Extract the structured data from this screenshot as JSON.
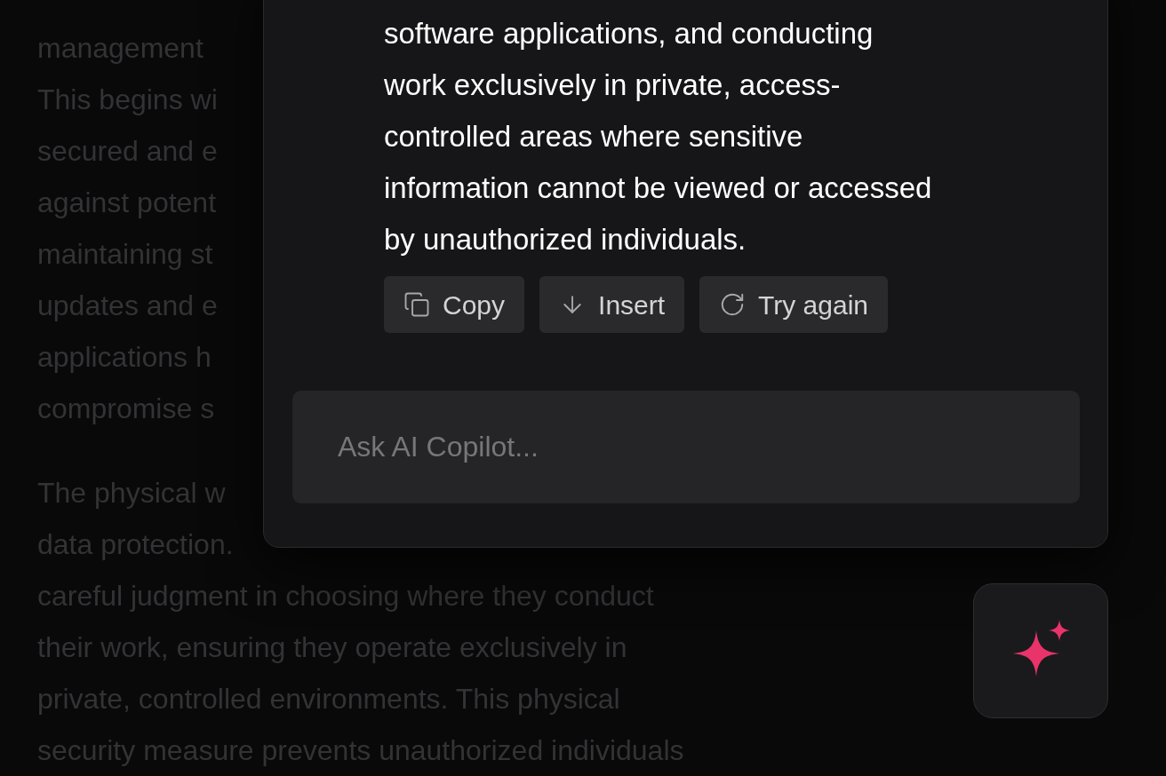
{
  "document": {
    "paragraphs": [
      {
        "lines": [
          "management",
          "This begins wi",
          "secured and e",
          "against potent",
          "maintaining st",
          "updates and e",
          "applications h",
          "compromise s"
        ]
      },
      {
        "lines": [
          "The physical w",
          "data protection.",
          "careful judgment in choosing where they conduct",
          "their work, ensuring they operate exclusively in",
          "private, controlled environments. This physical",
          "security measure prevents unauthorized individuals"
        ]
      }
    ]
  },
  "copilot": {
    "response": "software applications, and conducting work exclusively in private, access-controlled areas where sensitive information cannot be viewed or accessed by unauthorized individuals.",
    "actions": [
      {
        "kind": "copy",
        "label": "Copy"
      },
      {
        "kind": "insert",
        "label": "Insert"
      },
      {
        "kind": "retry",
        "label": "Try again"
      }
    ],
    "input": {
      "placeholder": "Ask AI Copilot..."
    }
  }
}
